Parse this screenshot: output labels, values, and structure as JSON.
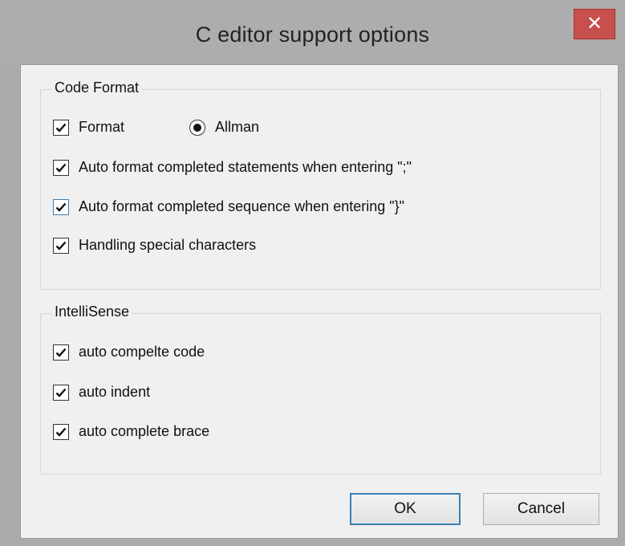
{
  "window": {
    "title": "C editor support  options",
    "close_glyph": "✕"
  },
  "code_format": {
    "legend": "Code Format",
    "format_label": "Format",
    "format_checked": true,
    "allman_label": "Allman",
    "allman_selected": true,
    "statements_label": "Auto format completed statements when entering \";\"",
    "statements_checked": true,
    "sequence_label": "Auto format completed sequence when entering \"}\"",
    "sequence_checked": true,
    "special_label": "Handling special characters",
    "special_checked": true
  },
  "intellisense": {
    "legend": "IntelliSense",
    "complete_code_label": "auto compelte code",
    "complete_code_checked": true,
    "indent_label": "auto indent",
    "indent_checked": true,
    "brace_label": "auto complete brace",
    "brace_checked": true
  },
  "buttons": {
    "ok": "OK",
    "cancel": "Cancel"
  },
  "colors": {
    "titlebar": "#adadad",
    "close_button": "#c7504c",
    "focus_border": "#3c7fb1",
    "client_bg": "#f0f0f0"
  },
  "icons": {
    "close": "close-icon",
    "checkbox": "checkmark-icon",
    "radio": "radio-dot-icon"
  }
}
